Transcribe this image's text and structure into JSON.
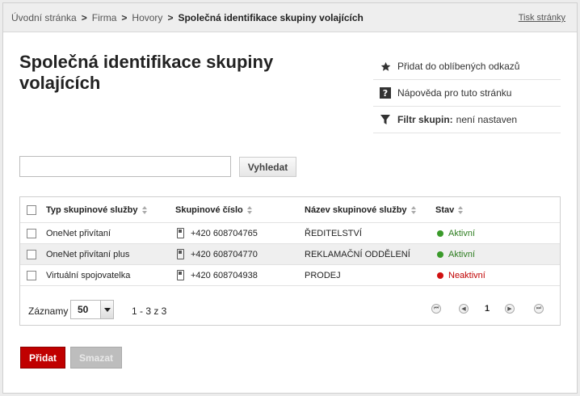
{
  "breadcrumb": {
    "items": [
      "Úvodní stránka",
      "Firma",
      "Hovory"
    ],
    "current": "Společná identifikace skupiny volajících",
    "separator": ">"
  },
  "print_label": "Tisk stránky",
  "page_title": "Společná identifikace skupiny volajících",
  "side": {
    "favorite_label": "Přidat do oblíbených odkazů",
    "help_label": "Nápověda pro tuto stránku",
    "filter_label": "Filtr skupin:",
    "filter_value": "není nastaven"
  },
  "search": {
    "value": "",
    "button_label": "Vyhledat"
  },
  "table": {
    "columns": [
      "Typ skupinové služby",
      "Skupinové číslo",
      "Název skupinové služby",
      "Stav"
    ],
    "rows": [
      {
        "type": "OneNet přivítaní",
        "number": "+420 608704765",
        "name": "ŘEDITELSTVÍ",
        "status": "Aktivní",
        "status_color": "#3a9a2a"
      },
      {
        "type": "OneNet přivítaní plus",
        "number": "+420 608704770",
        "name": "REKLAMAČNÍ ODDĚLENÍ",
        "status": "Aktivní",
        "status_color": "#3a9a2a"
      },
      {
        "type": "Virtuální spojovatelka",
        "number": "+420 608704938",
        "name": "PRODEJ",
        "status": "Neaktivní",
        "status_color": "#d01010"
      }
    ]
  },
  "pagination": {
    "records_label": "Záznamy",
    "page_size": "50",
    "range": "1 - 3 z 3",
    "current_page": "1"
  },
  "buttons": {
    "add": "Přidat",
    "delete": "Smazat"
  },
  "colors": {
    "accent": "#c00000",
    "active": "#3a9a2a",
    "inactive": "#d01010"
  }
}
